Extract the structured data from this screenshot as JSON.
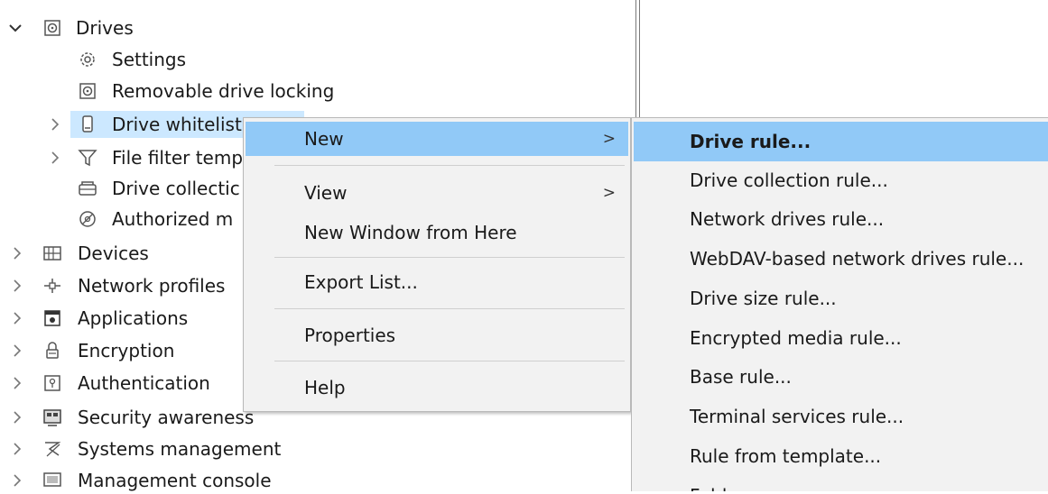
{
  "tree": {
    "items": [
      {
        "label": "Drives",
        "icon": "drive-icon",
        "chevron": "expanded"
      },
      {
        "label": "Settings",
        "icon": "gear-icon",
        "chevron": ""
      },
      {
        "label": "Removable drive locking",
        "icon": "drive-icon",
        "chevron": ""
      },
      {
        "label": "Drive whitelist",
        "icon": "usb-drive-icon",
        "chevron": "collapsed"
      },
      {
        "label": "File filter temp",
        "icon": "funnel-icon",
        "chevron": "collapsed"
      },
      {
        "label": "Drive collectic",
        "icon": "drive-collection-icon",
        "chevron": ""
      },
      {
        "label": "Authorized m",
        "icon": "authorized-media-icon",
        "chevron": ""
      },
      {
        "label": "Devices",
        "icon": "devices-icon",
        "chevron": "collapsed"
      },
      {
        "label": "Network profiles",
        "icon": "network-icon",
        "chevron": "collapsed"
      },
      {
        "label": "Applications",
        "icon": "applications-icon",
        "chevron": "collapsed"
      },
      {
        "label": "Encryption",
        "icon": "lock-icon",
        "chevron": "collapsed"
      },
      {
        "label": "Authentication",
        "icon": "authentication-icon",
        "chevron": "collapsed"
      },
      {
        "label": "Security awareness",
        "icon": "security-awareness-icon",
        "chevron": "collapsed"
      },
      {
        "label": "Systems management",
        "icon": "systems-management-icon",
        "chevron": "collapsed"
      },
      {
        "label": "Management console",
        "icon": "console-icon",
        "chevron": "collapsed"
      }
    ]
  },
  "context_menu": {
    "items": [
      {
        "label": "New",
        "has_submenu": true,
        "highlighted": true
      },
      {
        "label": "View",
        "has_submenu": true
      },
      {
        "label": "New Window from Here",
        "has_submenu": false
      },
      {
        "label": "Export List...",
        "has_submenu": false
      },
      {
        "label": "Properties",
        "has_submenu": false
      },
      {
        "label": "Help",
        "has_submenu": false
      }
    ],
    "submenu_arrow": ">"
  },
  "submenu": {
    "items": [
      {
        "label": "Drive rule...",
        "highlighted": true
      },
      {
        "label": "Drive collection rule..."
      },
      {
        "label": "Network drives rule..."
      },
      {
        "label": "WebDAV-based network drives rule..."
      },
      {
        "label": "Drive size rule..."
      },
      {
        "label": "Encrypted media rule..."
      },
      {
        "label": "Base rule..."
      },
      {
        "label": "Terminal services rule..."
      },
      {
        "label": "Rule from template..."
      },
      {
        "label": "Folder..."
      }
    ]
  },
  "colors": {
    "menu_background": "#f2f2f2",
    "menu_highlight": "#91c9f7",
    "selection": "#cce8ff"
  }
}
